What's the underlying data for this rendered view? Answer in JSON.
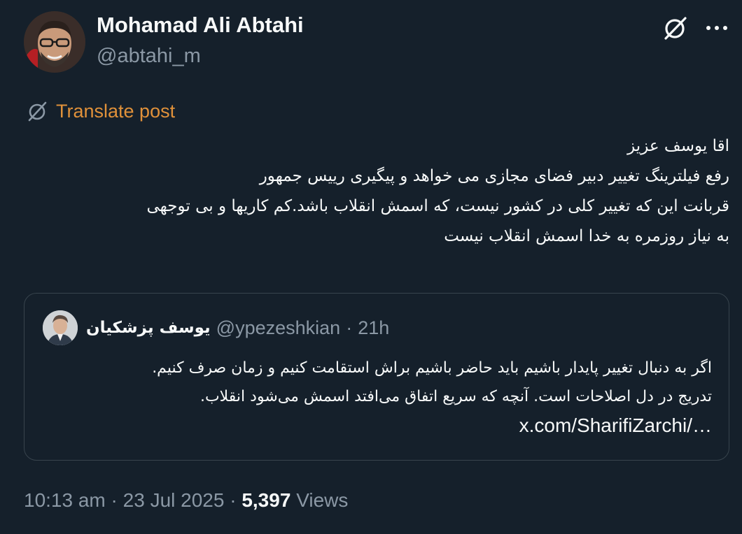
{
  "author": {
    "name": "Mohamad Ali Abtahi",
    "handle": "@abtahi_m"
  },
  "actions": {
    "grok_icon": "no-signal-icon",
    "more_icon": "more-horizontal-icon"
  },
  "translate": {
    "label": "Translate post",
    "color": "#e0913a"
  },
  "post": {
    "lines": [
      "اقا یوسف عزیز",
      "رفع فیلترینگ تغییر دبیر فضای مجازی می خواهد و پیگیری رییس جمهور",
      "قربانت این که تغییر کلی در کشور نیست، که اسمش انقلاب باشد.کم کاریها و بی توجهی",
      "به نیاز روزمره به خدا اسمش انقلاب نیست"
    ]
  },
  "quote": {
    "name": "یوسف پزشکیان",
    "handle": "@ypezeshkian",
    "separator": "·",
    "time": "21h",
    "lines": [
      "اگر به دنبال تغییر پایدار باشیم باید حاضر باشیم براش استقامت کنیم و زمان صرف کنیم.",
      "تدریج در دل اصلاحات است. آنچه که سریع اتفاق می‌افتد اسمش می‌شود انقلاب."
    ],
    "link": "x.com/SharifiZarchi/…"
  },
  "meta": {
    "time": "10:13 am",
    "sep1": "·",
    "date": "23 Jul 2025",
    "sep2": "·",
    "views_count": "5,397",
    "views_label": "Views"
  },
  "colors": {
    "background": "#15202b",
    "text_primary": "#f7f9f9",
    "text_secondary": "#8b98a5",
    "border": "#38444d"
  }
}
